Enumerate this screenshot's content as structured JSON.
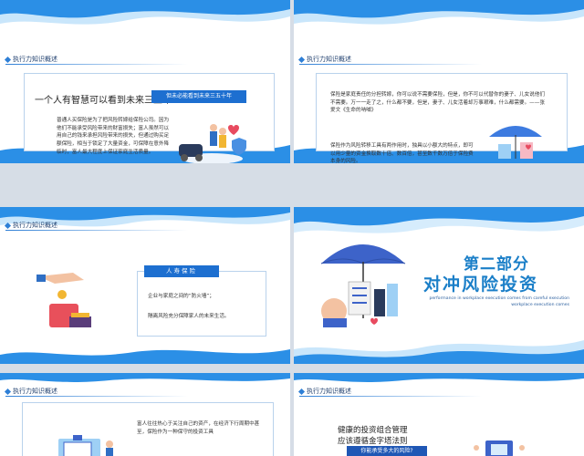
{
  "header": "执行力知识概述",
  "slide1": {
    "title": "一个人有智慧可以看到未来三五年",
    "pill": "但未必能看到未来三五十年",
    "body": "普通人买保险是为了把风险转嫁给保险公司。因为他们不能承受风险带来的财富损失；富人虽然可以用自己的钱来承担风险带来的损失，但通过购买足额保险，相当于锁定了大量资金，可保障在意外降临时，富人最大程度上保证家庭生活质量。"
  },
  "slide2": {
    "para1": "保险是家庭责任的分担转嫁，你可以说不需要保险，但是，你不可以代替你的妻子、儿女说他们不需要。万一一走了之，什么都不要，但是，妻子、儿女活着却万事艰难，什么都需要。——张爱文《生命的呐喊》",
    "para2": "保险作为风险转移工具有两作用时，独具以小额大的特点，即可以用少量的资金换取数十倍、数百倍，甚至数千数万倍于保险费本身的风险。"
  },
  "slide3": {
    "pill": "人寿保险",
    "item1": "企业与家庭之间的“防火墙”；",
    "item2": "隔离风险充分保障家人的未来生活。"
  },
  "slide4": {
    "part": "第二部分",
    "title": "对冲风险投资",
    "en1": "performance in workplace execution comes from careful execution",
    "en2": "workplace execution comes"
  },
  "slide5": {
    "body": "富人往往热心于关注自己的资产，在经济下行周期中甚至，保险作为一种保守的投资工具"
  },
  "slide6": {
    "line1": "健康的投资组合管理",
    "line2": "应该遵循金字塔法则",
    "pill": "你能承受多大的风险?"
  },
  "colors": {
    "accent": "#1d6fd0",
    "wave": "#2b8fe6"
  }
}
